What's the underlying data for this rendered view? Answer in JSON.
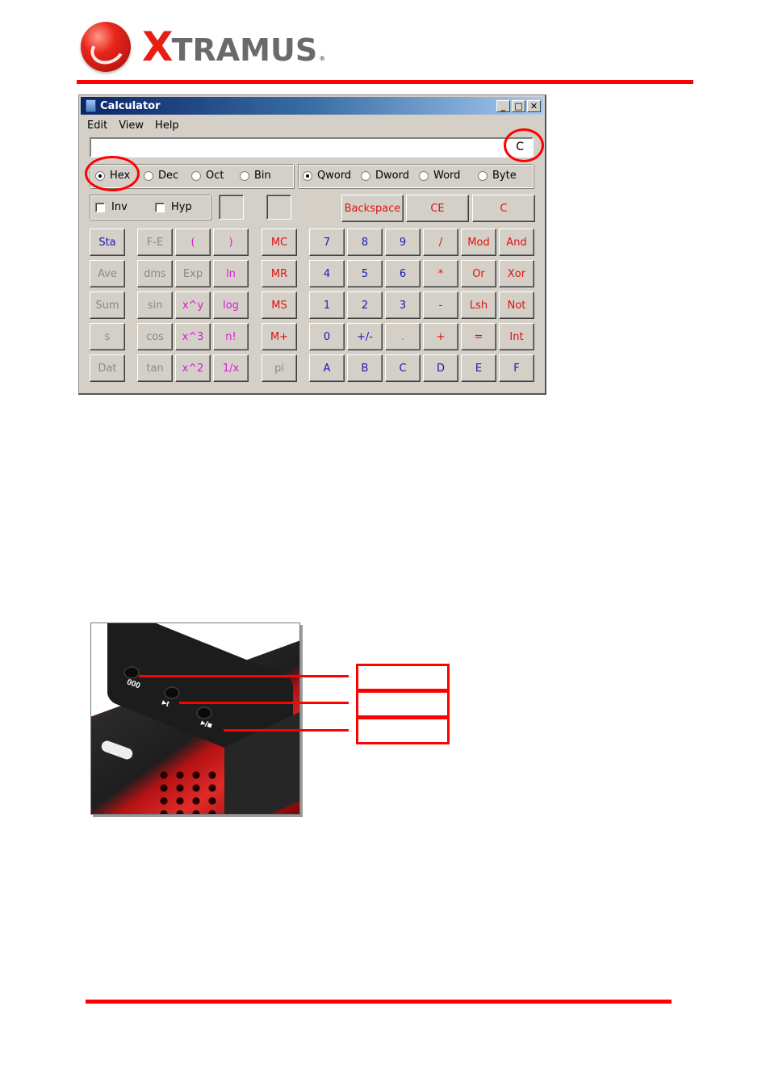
{
  "header": {
    "logo_x": "X",
    "logo_rest": "TRAMUS",
    "logo_reg": "®",
    "brand_color": "#e61e14"
  },
  "calculator": {
    "title": "Calculator",
    "title_buttons": [
      "_",
      "□",
      "✕"
    ],
    "menu": [
      "Edit",
      "View",
      "Help"
    ],
    "display_value": "C",
    "number_systems": [
      {
        "label": "Hex",
        "selected": true
      },
      {
        "label": "Dec",
        "selected": false
      },
      {
        "label": "Oct",
        "selected": false
      },
      {
        "label": "Bin",
        "selected": false
      }
    ],
    "word_sizes": [
      {
        "label": "Qword",
        "selected": true
      },
      {
        "label": "Dword",
        "selected": false
      },
      {
        "label": "Word",
        "selected": false
      },
      {
        "label": "Byte",
        "selected": false
      }
    ],
    "checkboxes": [
      {
        "label": "Inv",
        "checked": false
      },
      {
        "label": "Hyp",
        "checked": false
      }
    ],
    "top_buttons": [
      "Backspace",
      "CE",
      "C"
    ],
    "stat_keys": [
      "Sta",
      "Ave",
      "Sum",
      "s",
      "Dat"
    ],
    "sci_keys": [
      [
        "F-E",
        "(",
        ")"
      ],
      [
        "dms",
        "Exp",
        "ln"
      ],
      [
        "sin",
        "x^y",
        "log"
      ],
      [
        "cos",
        "x^3",
        "n!"
      ],
      [
        "tan",
        "x^2",
        "1/x"
      ]
    ],
    "mem_keys": [
      "MC",
      "MR",
      "MS",
      "M+",
      "pi"
    ],
    "num_keys": [
      [
        "7",
        "8",
        "9",
        "/",
        "Mod",
        "And"
      ],
      [
        "4",
        "5",
        "6",
        "*",
        "Or",
        "Xor"
      ],
      [
        "1",
        "2",
        "3",
        "-",
        "Lsh",
        "Not"
      ],
      [
        "0",
        "+/-",
        ".",
        "+",
        "=",
        "Int"
      ],
      [
        "A",
        "B",
        "C",
        "D",
        "E",
        "F"
      ]
    ],
    "highlight_color": "#ff0000"
  },
  "photo": {
    "button_labels": [
      "000",
      "▸t",
      "▸/■"
    ]
  },
  "callouts": [
    "",
    "",
    ""
  ]
}
